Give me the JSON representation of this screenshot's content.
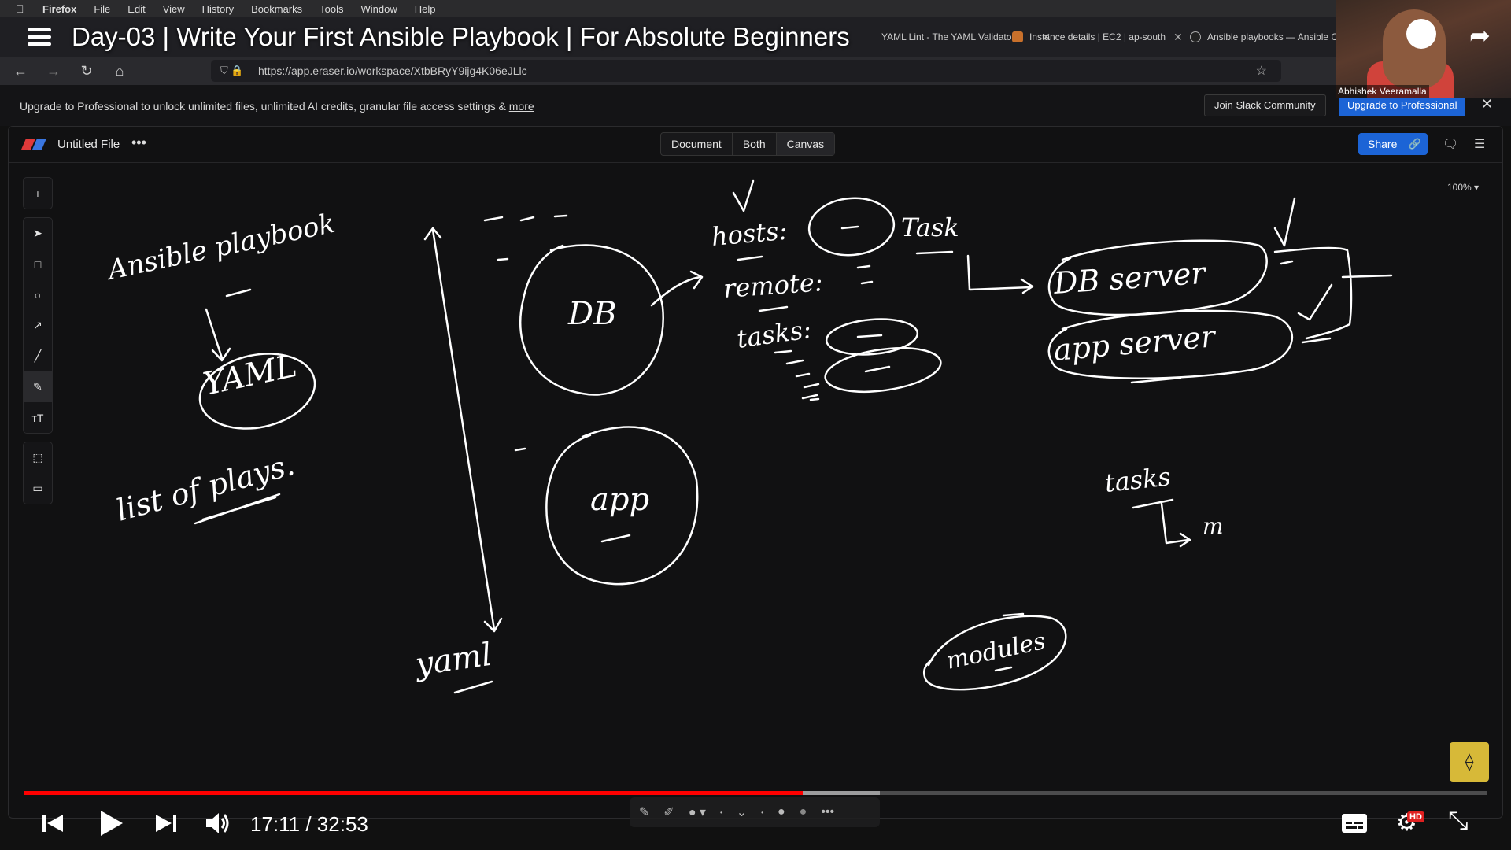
{
  "menubar": {
    "app": "Firefox",
    "items": [
      "File",
      "Edit",
      "View",
      "History",
      "Bookmarks",
      "Tools",
      "Window",
      "Help"
    ]
  },
  "tabs": [
    {
      "label": "YAML Lint - The YAML Validator",
      "icon": "yaml-lint-favicon"
    },
    {
      "label": "Instance details | EC2 | ap-south",
      "icon": "aws-favicon"
    },
    {
      "label": "Ansible playbooks — Ansible Co",
      "icon": "ansible-favicon"
    }
  ],
  "youtube": {
    "title": "Day-03 | Write Your First Ansible Playbook | For Absolute Beginners",
    "time": "17:11 / 32:53",
    "progress": 0.532,
    "buffered": 0.585,
    "hd_badge": "HD",
    "presenter": "Abhishek Veeramalla"
  },
  "browser": {
    "url": "https://app.eraser.io/workspace/XtbBRyY9ijg4K06eJLlc"
  },
  "banner": {
    "text": "Upgrade to Professional to unlock unlimited files, unlimited AI credits, granular file access settings & ",
    "more": "more",
    "slack_button": "Join Slack Community",
    "upgrade_button": "Upgrade to Professional"
  },
  "eraser": {
    "filename": "Untitled File",
    "file_menu": "•••",
    "views": [
      "Document",
      "Both",
      "Canvas"
    ],
    "share": "Share",
    "zoom": "100%"
  },
  "canvas_text": {
    "ansible_playbook": "Ansible playbook",
    "yaml_left": "YAML",
    "list_of_plays": "list of plays.",
    "db": "DB",
    "app": "app",
    "yaml_bottom": "yaml",
    "hosts": "hosts:",
    "task": "Task",
    "remote": "remote:",
    "tasks": "tasks:",
    "db_server": "DB server",
    "app_server": "app server",
    "tasks2": "tasks",
    "m": "m",
    "modules": "modules"
  },
  "colors": {
    "accent": "#1c64d6",
    "progress": "#ff0000",
    "ink": "#ffffff"
  }
}
